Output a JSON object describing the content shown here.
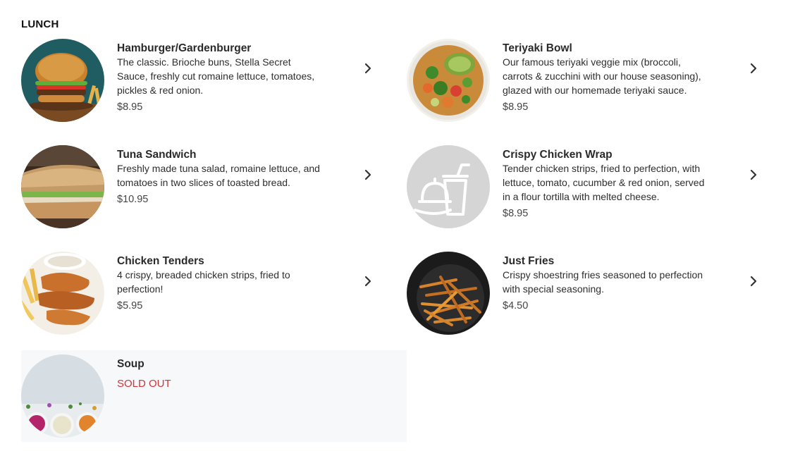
{
  "section": {
    "title": "LUNCH"
  },
  "items": [
    {
      "name": "Hamburger/Gardenburger",
      "description": "The classic. Brioche buns, Stella Secret Sauce, freshly cut romaine lettuce, tomatoes, pickles & red onion.",
      "price": "$8.95"
    },
    {
      "name": "Teriyaki Bowl",
      "description": "Our famous teriyaki veggie mix (broccoli, carrots & zucchini with our house seasoning), glazed with our homemade teriyaki sauce.",
      "price": "$8.95"
    },
    {
      "name": "Tuna Sandwich",
      "description": "Freshly made tuna salad, romaine lettuce, and tomatoes in two slices of toasted bread.",
      "price": "$10.95"
    },
    {
      "name": "Crispy Chicken Wrap",
      "description": "Tender chicken strips, fried to perfection, with lettuce, tomato, cucumber & red onion, served in a flour tortilla with melted cheese.",
      "price": "$8.95"
    },
    {
      "name": "Chicken Tenders",
      "description": "4 crispy, breaded chicken strips, fried to perfection!",
      "price": "$5.95"
    },
    {
      "name": "Just Fries",
      "description": "Crispy shoestring fries seasoned to perfection with special seasoning.",
      "price": "$4.50"
    },
    {
      "name": "Soup",
      "status": "SOLD OUT"
    }
  ],
  "colors": {
    "sold_out_text": "#d0343a",
    "sold_out_background": "#f7f8f9",
    "placeholder_gray": "#d5d5d5"
  },
  "icons": {
    "chevron": "chevron-right-icon",
    "placeholder": "food-placeholder-icon"
  }
}
